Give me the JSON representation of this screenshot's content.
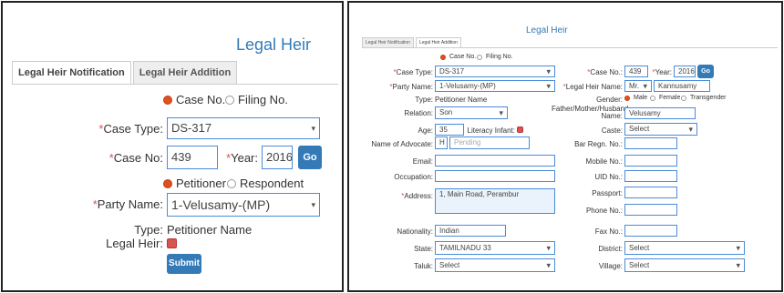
{
  "left": {
    "title": "Legal Heir",
    "tabs": [
      "Legal Heir Notification",
      "Legal Heir Addition"
    ],
    "radio_case": "Case No.",
    "radio_filing": "Filing No.",
    "case_type_label": "Case Type:",
    "case_type_value": "DS-317",
    "case_no_label": "Case No:",
    "case_no_value": "439",
    "year_label": "Year:",
    "year_value": "2016",
    "go_label": "Go",
    "radio_petitioner": "Petitioner",
    "radio_respondent": "Respondent",
    "party_name_label": "Party Name:",
    "party_name_value": "1-Velusamy-(MP)",
    "type_label": "Type:",
    "type_value": "Petitioner Name",
    "legal_heir_label": "Legal Heir:",
    "submit_label": "Submit"
  },
  "right": {
    "title": "Legal Heir",
    "tabs": [
      "Legal Heir Notification",
      "Legal Heir Addition"
    ],
    "radio_case": "Case No.",
    "radio_filing": "Filing No.",
    "case_type_label": "Case Type:",
    "case_type_value": "DS-317",
    "party_name_label": "Party Name:",
    "party_name_value": "1-Velusamy-(MP)",
    "type_label": "Type:",
    "type_value": "Petitioner Name",
    "relation_label": "Relation:",
    "relation_value": "Son",
    "age_label": "Age:",
    "age_value": "35",
    "literacy_label": "Literacy Infant:",
    "advocate_label": "Name of Advocate:",
    "advocate_prefix": "H",
    "advocate_placeholder": "Pending",
    "email_label": "Email:",
    "occupation_label": "Occupation:",
    "address_label": "Address:",
    "address_value": "1, Main Road, Perambur",
    "nationality_label": "Nationality:",
    "nationality_value": "Indian",
    "state_label": "State:",
    "state_value": "TAMILNADU 33",
    "taluk_label": "Taluk:",
    "taluk_value": "Select",
    "case_no_label": "Case No.:",
    "case_no_value": "439",
    "year_label": "Year:",
    "year_value": "2016",
    "go_label": "Go",
    "lh_name_label": "Legal Heir Name:",
    "lh_prefix": "Mr.",
    "lh_name_value": "Kannusamy",
    "gender_label": "Gender:",
    "gender_male": "Male",
    "gender_female": "Female",
    "gender_trans": "Transgender",
    "father_label": "Father/Mother/Husband Name:",
    "father_value": "Velusamy",
    "caste_label": "Caste:",
    "caste_value": "Select",
    "bar_reg_label": "Bar Regn. No.:",
    "mobile_label": "Mobile No.:",
    "uid_label": "UID No.:",
    "passport_label": "Passport:",
    "phone_label": "Phone No.:",
    "fax_label": "Fax No.:",
    "district_label": "District:",
    "district_value": "Select",
    "village_label": "Village:",
    "village_value": "Select"
  },
  "colors": {
    "accent": "#337ab7",
    "checked": "#e05020",
    "input_border": "#4a8bd8"
  }
}
